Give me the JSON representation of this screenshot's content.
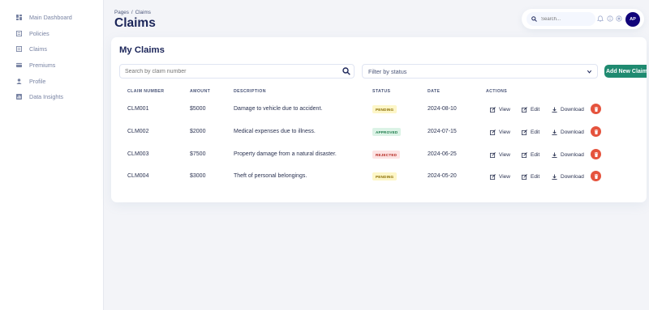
{
  "sidebar": {
    "items": [
      {
        "label": "Main Dashboard",
        "icon": "dashboard-icon"
      },
      {
        "label": "Policies",
        "icon": "document-icon"
      },
      {
        "label": "Claims",
        "icon": "document-icon"
      },
      {
        "label": "Premiums",
        "icon": "credit-card-icon"
      },
      {
        "label": "Profile",
        "icon": "user-icon"
      },
      {
        "label": "Data Insights",
        "icon": "chart-icon"
      }
    ]
  },
  "header": {
    "breadcrumb": [
      "Pages",
      "/",
      "Claims"
    ],
    "title": "Claims",
    "search_placeholder": "Search...",
    "avatar_initials": "AP"
  },
  "claims": {
    "title": "My Claims",
    "search_placeholder": "Search by claim number",
    "filter_label": "Filter by status",
    "add_button": "Add New Claim",
    "columns": [
      "CLAIM NUMBER",
      "AMOUNT",
      "DESCRIPTION",
      "STATUS",
      "DATE",
      "ACTIONS"
    ],
    "actions": {
      "view": "View",
      "edit": "Edit",
      "download": "Download"
    },
    "rows": [
      {
        "number": "CLM001",
        "amount": "$5000",
        "description": "Damage to vehicle due to accident.",
        "status": "PENDING",
        "date": "2024-08-10"
      },
      {
        "number": "CLM002",
        "amount": "$2000",
        "description": "Medical expenses due to illness.",
        "status": "APPROVED",
        "date": "2024-07-15"
      },
      {
        "number": "CLM003",
        "amount": "$7500",
        "description": "Property damage from a natural disaster.",
        "status": "REJECTED",
        "date": "2024-06-25"
      },
      {
        "number": "CLM004",
        "amount": "$3000",
        "description": "Theft of personal belongings.",
        "status": "PENDING",
        "date": "2024-05-20"
      }
    ]
  },
  "colors": {
    "accent": "#1f8a70",
    "avatar": "#11047a",
    "delete": "#e5533d",
    "pending_bg": "#fdf6c8",
    "approved_bg": "#dcf3e6",
    "rejected_bg": "#fde4e4"
  }
}
